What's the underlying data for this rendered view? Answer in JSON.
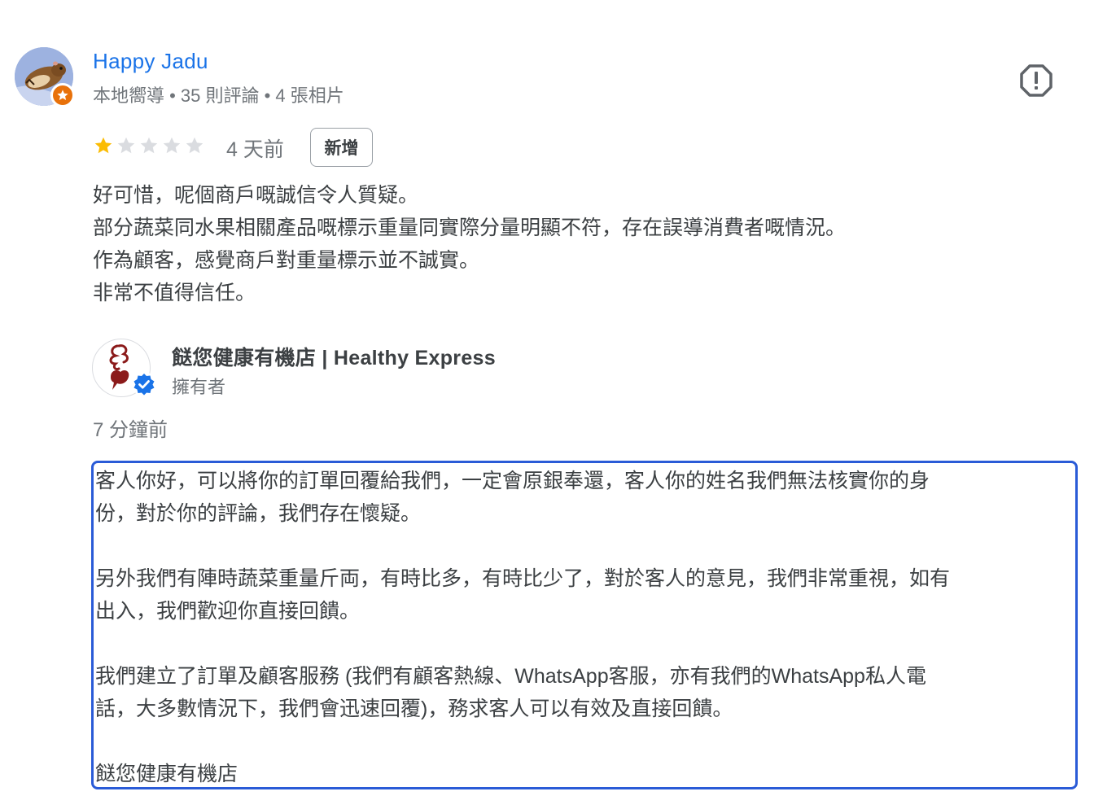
{
  "review": {
    "reviewer_name": "Happy Jadu",
    "reviewer_meta": "本地嚮導 • 35 則評論 • 4 張相片",
    "avatar_icon": "hamster-avatar-icon",
    "guide_badge_icon": "star-icon",
    "report_icon": "flag-report-icon",
    "rating": 1,
    "max_rating": 5,
    "star_filled_color": "#fbbc04",
    "star_empty_color": "#dadce0",
    "time": "4 天前",
    "badge": "新增",
    "lines": [
      "好可惜，呢個商戶嘅誠信令人質疑。",
      "部分蔬菜同水果相關產品嘅標示重量同實際分量明顯不符，存在誤導消費者嘅情況。",
      "作為顧客，感覺商戶對重量標示並不誠實。",
      "非常不值得信任。"
    ]
  },
  "owner_reply": {
    "owner_name": "餸您健康有機店 | Healthy Express",
    "owner_role": "擁有者",
    "logo_icon": "healthy-express-logo",
    "verified_icon": "verified-check-icon",
    "time": "7 分鐘前",
    "lines": [
      "客人你好，可以將你的訂單回覆給我們，一定會原銀奉還，客人你的姓名我們無法核實你的身",
      "份，對於你的評論，我們存在懷疑。",
      "",
      "另外我們有陣時蔬菜重量斤両，有時比多，有時比少了，對於客人的意見，我們非常重視，如有",
      "出入，我們歡迎你直接回饋。",
      "",
      "我們建立了訂單及顧客服務 (我們有顧客熱線、WhatsApp客服，亦有我們的WhatsApp私人電",
      "話，大多數情況下，我們會迅速回覆)，務求客人可以有效及直接回饋。",
      "",
      "餸您健康有機店"
    ]
  },
  "colors": {
    "link_blue": "#1a73e8",
    "selection_border": "#2a5bd7",
    "guide_orange": "#e8710a",
    "logo_red": "#8b1a1a"
  }
}
